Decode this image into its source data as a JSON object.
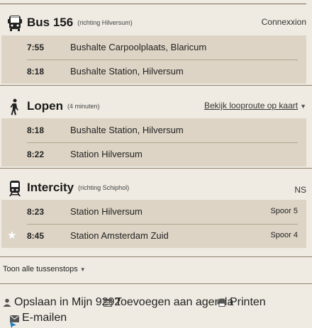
{
  "legs": [
    {
      "mode_icon": "bus-icon",
      "title": "Bus 156",
      "direction": "(richting Hilversum)",
      "operator": "Connexxion",
      "stops": [
        {
          "time": "7:55",
          "place": "Bushalte Carpoolplaats, Blaricum"
        },
        {
          "time": "8:18",
          "place": "Bushalte Station, Hilversum"
        }
      ]
    },
    {
      "mode_icon": "walking-person-icon",
      "title": "Lopen",
      "duration": "(4 minuten)",
      "map_link": "Bekijk looproute op kaart",
      "stops": [
        {
          "time": "8:18",
          "place": "Bushalte Station, Hilversum"
        },
        {
          "time": "8:22",
          "place": "Station Hilversum"
        }
      ]
    },
    {
      "mode_icon": "train-icon",
      "title": "Intercity",
      "direction": "(richting Schiphol)",
      "operator": "NS",
      "stops": [
        {
          "time": "8:23",
          "place": "Station Hilversum",
          "platform": "Spoor 5"
        },
        {
          "time": "8:45",
          "place": "Station Amsterdam Zuid",
          "platform": "Spoor 4"
        }
      ]
    }
  ],
  "toon_alle": "Toon alle tussenstops",
  "actions": {
    "save": "Opslaan in Mijn 9292",
    "calendar": "Toevoegen aan agenda",
    "print": "Printen",
    "email": "E-mailen"
  }
}
